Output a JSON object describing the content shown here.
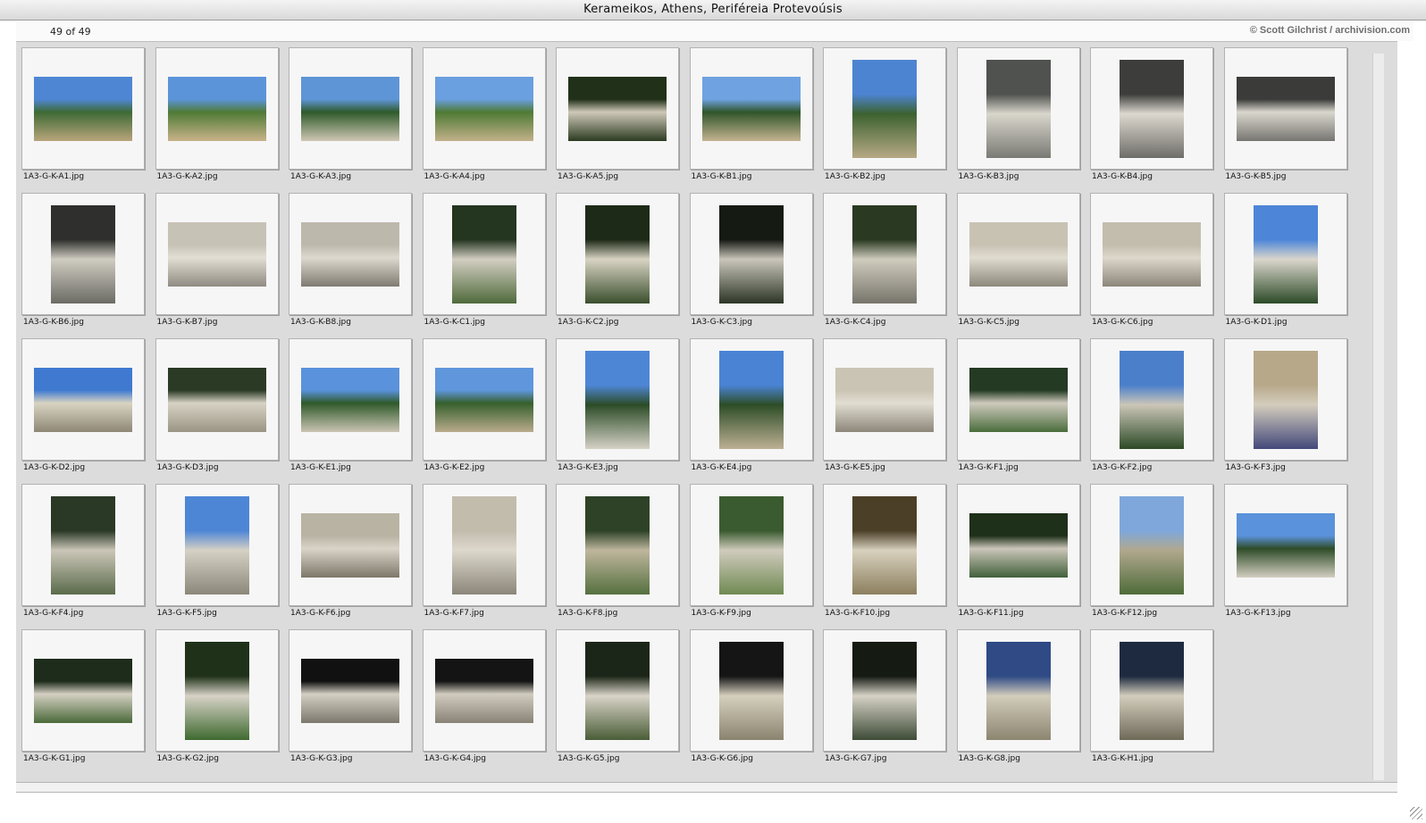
{
  "window": {
    "title": "Kerameikos, Athens, Periféreia Protevoúsis",
    "count_label": "49 of 49",
    "copyright": "© Scott Gilchrist / archivision.com"
  },
  "thumbnails": [
    {
      "name": "1A3-G-K-A1.jpg",
      "orientation": "land",
      "colors": [
        "#4f86d4",
        "#3e6a35",
        "#b9a57c"
      ]
    },
    {
      "name": "1A3-G-K-A2.jpg",
      "orientation": "land",
      "colors": [
        "#5c94da",
        "#4f7a36",
        "#c9b389"
      ]
    },
    {
      "name": "1A3-G-K-A3.jpg",
      "orientation": "land",
      "colors": [
        "#5e95d6",
        "#2f5a2b",
        "#cfc7b4"
      ]
    },
    {
      "name": "1A3-G-K-A4.jpg",
      "orientation": "land",
      "colors": [
        "#6a9fe0",
        "#4e7a34",
        "#c2b18a"
      ]
    },
    {
      "name": "1A3-G-K-A5.jpg",
      "orientation": "land",
      "colors": [
        "#213019",
        "#cfc8b8",
        "#2c3b22"
      ]
    },
    {
      "name": "1A3-G-K-B1.jpg",
      "orientation": "land",
      "colors": [
        "#6ea2e0",
        "#30552a",
        "#c4b491"
      ]
    },
    {
      "name": "1A3-G-K-B2.jpg",
      "orientation": "port",
      "colors": [
        "#4d84d2",
        "#3c6230",
        "#b7a985"
      ]
    },
    {
      "name": "1A3-G-K-B3.jpg",
      "orientation": "port",
      "colors": [
        "#50524f",
        "#d9d6cc",
        "#7a7a74"
      ]
    },
    {
      "name": "1A3-G-K-B4.jpg",
      "orientation": "port",
      "colors": [
        "#3d3e3c",
        "#dcd8cf",
        "#6e6d68"
      ]
    },
    {
      "name": "1A3-G-K-B5.jpg",
      "orientation": "land",
      "colors": [
        "#3b3b39",
        "#dad7ce",
        "#777570"
      ]
    },
    {
      "name": "1A3-G-K-B6.jpg",
      "orientation": "port",
      "colors": [
        "#2f302d",
        "#cfccc1",
        "#6b6a64"
      ]
    },
    {
      "name": "1A3-G-K-B7.jpg",
      "orientation": "land",
      "colors": [
        "#c7c2b6",
        "#e2ded3",
        "#8f8b82"
      ]
    },
    {
      "name": "1A3-G-K-B8.jpg",
      "orientation": "land",
      "colors": [
        "#bdb8ac",
        "#ddd9ce",
        "#7f7b72"
      ]
    },
    {
      "name": "1A3-G-K-C1.jpg",
      "orientation": "port",
      "colors": [
        "#243520",
        "#d2cec2",
        "#4f6a3b"
      ]
    },
    {
      "name": "1A3-G-K-C2.jpg",
      "orientation": "port",
      "colors": [
        "#1d2a17",
        "#d8d3c3",
        "#3a4f2d"
      ]
    },
    {
      "name": "1A3-G-K-C3.jpg",
      "orientation": "port",
      "colors": [
        "#151a13",
        "#c9c5bb",
        "#2c3526"
      ]
    },
    {
      "name": "1A3-G-K-C4.jpg",
      "orientation": "port",
      "colors": [
        "#2a3a22",
        "#cfcbbd",
        "#77756b"
      ]
    },
    {
      "name": "1A3-G-K-C5.jpg",
      "orientation": "land",
      "colors": [
        "#c8c2b3",
        "#e0dccf",
        "#8d887c"
      ]
    },
    {
      "name": "1A3-G-K-C6.jpg",
      "orientation": "land",
      "colors": [
        "#c3bdae",
        "#ddd8cb",
        "#8c867a"
      ]
    },
    {
      "name": "1A3-G-K-D1.jpg",
      "orientation": "port",
      "colors": [
        "#4d85d8",
        "#dad6cc",
        "#2c4a27"
      ]
    },
    {
      "name": "1A3-G-K-D2.jpg",
      "orientation": "land",
      "colors": [
        "#3f7ad0",
        "#d9d3c2",
        "#8e8776"
      ]
    },
    {
      "name": "1A3-G-K-D3.jpg",
      "orientation": "land",
      "colors": [
        "#2a3a25",
        "#d7d2c4",
        "#9a9484"
      ]
    },
    {
      "name": "1A3-G-K-E1.jpg",
      "orientation": "land",
      "colors": [
        "#5a92dc",
        "#2f5a2b",
        "#cbc4b3"
      ]
    },
    {
      "name": "1A3-G-K-E2.jpg",
      "orientation": "land",
      "colors": [
        "#5f96dc",
        "#36602d",
        "#b9ab8c"
      ]
    },
    {
      "name": "1A3-G-K-E3.jpg",
      "orientation": "port",
      "colors": [
        "#4e86d6",
        "#2c4c27",
        "#d5d1c6"
      ]
    },
    {
      "name": "1A3-G-K-E4.jpg",
      "orientation": "port",
      "colors": [
        "#4a83d4",
        "#2d4d27",
        "#bdb094"
      ]
    },
    {
      "name": "1A3-G-K-E5.jpg",
      "orientation": "land",
      "colors": [
        "#cac4b4",
        "#e1ddd1",
        "#8d877a"
      ]
    },
    {
      "name": "1A3-G-K-F1.jpg",
      "orientation": "land",
      "colors": [
        "#243a22",
        "#cfcabd",
        "#4a6d3c"
      ]
    },
    {
      "name": "1A3-G-K-F2.jpg",
      "orientation": "port",
      "colors": [
        "#4b7fca",
        "#cbc6b8",
        "#2c4a26"
      ]
    },
    {
      "name": "1A3-G-K-F3.jpg",
      "orientation": "port",
      "colors": [
        "#b7a88a",
        "#d4cdbd",
        "#43487a"
      ]
    },
    {
      "name": "1A3-G-K-F4.jpg",
      "orientation": "port",
      "colors": [
        "#2a3826",
        "#cbc6b8",
        "#5a6b4a"
      ]
    },
    {
      "name": "1A3-G-K-F5.jpg",
      "orientation": "port",
      "colors": [
        "#4e86d6",
        "#d6d1c5",
        "#8b8779"
      ]
    },
    {
      "name": "1A3-G-K-F6.jpg",
      "orientation": "land",
      "colors": [
        "#b9b3a4",
        "#d9d4c7",
        "#7d776a"
      ]
    },
    {
      "name": "1A3-G-K-F7.jpg",
      "orientation": "port",
      "colors": [
        "#c2bcad",
        "#ddd8cc",
        "#8b8679"
      ]
    },
    {
      "name": "1A3-G-K-F8.jpg",
      "orientation": "port",
      "colors": [
        "#2d4227",
        "#bfb69d",
        "#55703f"
      ]
    },
    {
      "name": "1A3-G-K-F9.jpg",
      "orientation": "port",
      "colors": [
        "#3a5a2f",
        "#d0cbbd",
        "#6f8a52"
      ]
    },
    {
      "name": "1A3-G-K-F10.jpg",
      "orientation": "port",
      "colors": [
        "#4b3f27",
        "#d8d1be",
        "#8c7f5e"
      ]
    },
    {
      "name": "1A3-G-K-F11.jpg",
      "orientation": "land",
      "colors": [
        "#1e3019",
        "#cbc6b9",
        "#41603a"
      ]
    },
    {
      "name": "1A3-G-K-F12.jpg",
      "orientation": "port",
      "colors": [
        "#7fa7dc",
        "#b1a88d",
        "#4e6b39"
      ]
    },
    {
      "name": "1A3-G-K-F13.jpg",
      "orientation": "land",
      "colors": [
        "#5a92db",
        "#2e4c28",
        "#d3cec1"
      ]
    },
    {
      "name": "1A3-G-K-G1.jpg",
      "orientation": "land",
      "colors": [
        "#1d2c1b",
        "#d4cfc2",
        "#4b6a3a"
      ]
    },
    {
      "name": "1A3-G-K-G2.jpg",
      "orientation": "port",
      "colors": [
        "#1f3219",
        "#d7d2c7",
        "#3f6a30"
      ]
    },
    {
      "name": "1A3-G-K-G3.jpg",
      "orientation": "land",
      "colors": [
        "#111111",
        "#d4cfc3",
        "#7c786d"
      ]
    },
    {
      "name": "1A3-G-K-G4.jpg",
      "orientation": "land",
      "colors": [
        "#141414",
        "#d1ccbf",
        "#888376"
      ]
    },
    {
      "name": "1A3-G-K-G5.jpg",
      "orientation": "port",
      "colors": [
        "#1c2618",
        "#d9d4c8",
        "#4a5d37"
      ]
    },
    {
      "name": "1A3-G-K-G6.jpg",
      "orientation": "port",
      "colors": [
        "#151515",
        "#d5cfbe",
        "#8a846f"
      ]
    },
    {
      "name": "1A3-G-K-G7.jpg",
      "orientation": "port",
      "colors": [
        "#151a13",
        "#d6d2c6",
        "#3d4b36"
      ]
    },
    {
      "name": "1A3-G-K-G8.jpg",
      "orientation": "port",
      "colors": [
        "#2f4a85",
        "#d2ccbb",
        "#8c8570"
      ]
    },
    {
      "name": "1A3-G-K-H1.jpg",
      "orientation": "port",
      "colors": [
        "#1e2a3f",
        "#d3cdbd",
        "#6f6a58"
      ]
    }
  ]
}
